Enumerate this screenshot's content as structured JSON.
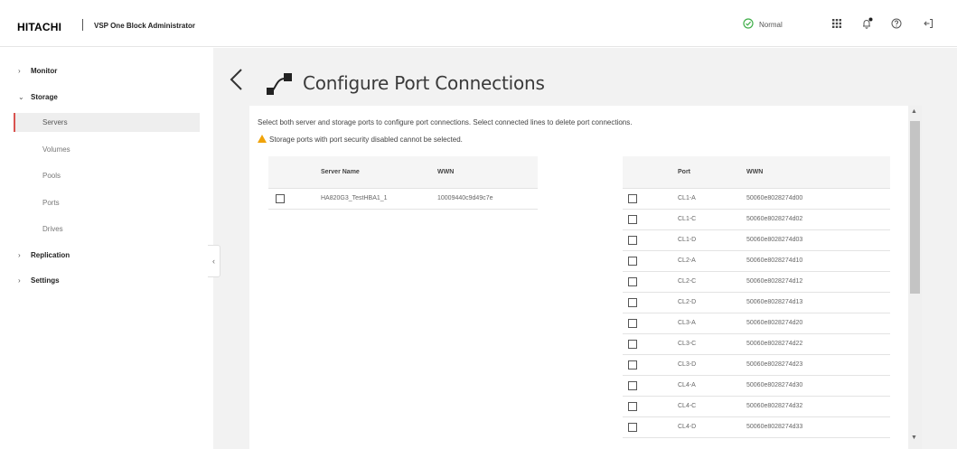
{
  "header": {
    "brand": "HITACHI",
    "product": "VSP One Block Administrator",
    "status": "Normal",
    "icons": [
      "status-ok-icon",
      "apps-grid-icon",
      "notification-bell-icon",
      "help-icon",
      "logout-icon"
    ],
    "colors": {
      "status_ok": "#3fae49",
      "notification_dot": "#222222"
    }
  },
  "sidebar": {
    "items": [
      {
        "label": "Monitor",
        "expanded": false
      },
      {
        "label": "Storage",
        "expanded": true,
        "children": [
          {
            "label": "Servers",
            "active": true
          },
          {
            "label": "Volumes"
          },
          {
            "label": "Pools"
          },
          {
            "label": "Ports"
          },
          {
            "label": "Drives"
          }
        ]
      },
      {
        "label": "Replication",
        "expanded": false
      },
      {
        "label": "Settings",
        "expanded": false
      }
    ],
    "collapse_glyph": "‹",
    "colors": {
      "active_marker": "#d9534f"
    }
  },
  "page": {
    "title": "Configure Port Connections",
    "instruction": "Select both server and storage ports to configure port connections. Select connected lines to delete port connections.",
    "warning": "Storage ports with port security disabled cannot be selected.",
    "colors": {
      "warning": "#f0a30a"
    }
  },
  "server_table": {
    "headers": [
      "",
      "Server Name",
      "WWN"
    ],
    "rows": [
      {
        "name": "HA820G3_TestHBA1_1",
        "wwn": "10009440c9d49c7e"
      }
    ]
  },
  "port_table": {
    "headers": [
      "",
      "Port",
      "WWN"
    ],
    "rows": [
      {
        "port": "CL1-A",
        "wwn": "50060e8028274d00"
      },
      {
        "port": "CL1-C",
        "wwn": "50060e8028274d02"
      },
      {
        "port": "CL1-D",
        "wwn": "50060e8028274d03"
      },
      {
        "port": "CL2-A",
        "wwn": "50060e8028274d10"
      },
      {
        "port": "CL2-C",
        "wwn": "50060e8028274d12"
      },
      {
        "port": "CL2-D",
        "wwn": "50060e8028274d13"
      },
      {
        "port": "CL3-A",
        "wwn": "50060e8028274d20"
      },
      {
        "port": "CL3-C",
        "wwn": "50060e8028274d22"
      },
      {
        "port": "CL3-D",
        "wwn": "50060e8028274d23"
      },
      {
        "port": "CL4-A",
        "wwn": "50060e8028274d30"
      },
      {
        "port": "CL4-C",
        "wwn": "50060e8028274d32"
      },
      {
        "port": "CL4-D",
        "wwn": "50060e8028274d33"
      }
    ]
  }
}
